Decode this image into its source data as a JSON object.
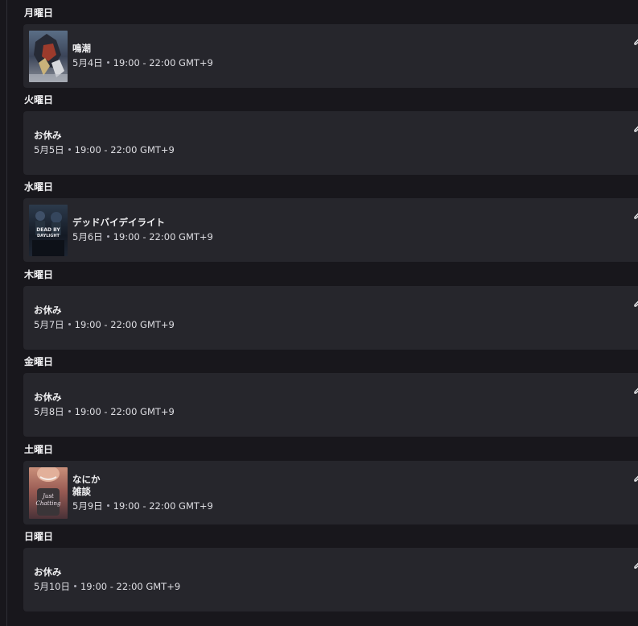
{
  "colors": {
    "background": "#18171c",
    "card": "#26262c",
    "text": "#efeff1",
    "muted": "#adadb8"
  },
  "schedule": [
    {
      "day": "月曜日",
      "title": "鳴潮",
      "date": "5月4日",
      "time": "19:00 - 22:00 GMT+9",
      "thumbnail": "wuthering-waves-cover"
    },
    {
      "day": "火曜日",
      "title": "お休み",
      "date": "5月5日",
      "time": "19:00 - 22:00 GMT+9",
      "thumbnail": null
    },
    {
      "day": "水曜日",
      "title": "デッドバイデイライト",
      "date": "5月6日",
      "time": "19:00 - 22:00 GMT+9",
      "thumbnail": "dead-by-daylight-cover",
      "thumbnail_text": "DEAD BY DAYLIGHT"
    },
    {
      "day": "木曜日",
      "title": "お休み",
      "date": "5月7日",
      "time": "19:00 - 22:00 GMT+9",
      "thumbnail": null
    },
    {
      "day": "金曜日",
      "title": "お休み",
      "date": "5月8日",
      "time": "19:00 - 22:00 GMT+9",
      "thumbnail": null
    },
    {
      "day": "土曜日",
      "title": "なにか\n雑談",
      "date": "5月9日",
      "time": "19:00 - 22:00 GMT+9",
      "thumbnail": "just-chatting-cover",
      "thumbnail_text": "Just Chatting"
    },
    {
      "day": "日曜日",
      "title": "お休み",
      "date": "5月10日",
      "time": "19:00 - 22:00 GMT+9",
      "thumbnail": null
    }
  ],
  "edit_icon": "pencil-icon"
}
